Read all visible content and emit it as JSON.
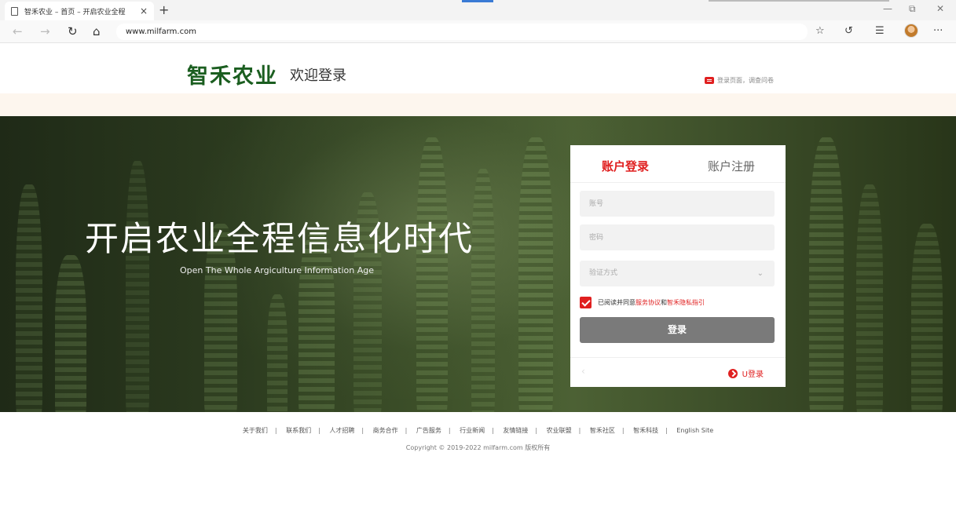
{
  "browser": {
    "tab_title": "智禾农业 – 首页 – 开启农业全程",
    "tab_close": "×",
    "new_tab": "+",
    "url": "www.milfarm.com",
    "window_controls": {
      "minimize": "—",
      "restore": "⧉",
      "close": "✕"
    }
  },
  "header": {
    "logo": "智禾农业",
    "welcome": "欢迎登录",
    "notice": "登录页面，调查问卷"
  },
  "hero": {
    "title": "开启农业全程信息化时代",
    "subtitle": "Open The Whole Argiculture Information Age"
  },
  "login": {
    "tab_login": "账户登录",
    "tab_register": "账户注册",
    "account_placeholder": "账号",
    "password_placeholder": "密码",
    "verify_label": "验证方式",
    "agree_prefix": "已阅读并同意",
    "service_agreement": "服务协议",
    "and": "和",
    "privacy_guide": "智禾隐私指引",
    "submit": "登录",
    "u_login": "U登录",
    "accent_color": "#e02020"
  },
  "footer": {
    "links": [
      "关于我们",
      "联系我们",
      "人才招聘",
      "商务合作",
      "广告服务",
      "行业新闻",
      "友情链接",
      "农业联盟",
      "智禾社区",
      "智禾科技",
      "English Site"
    ],
    "separator": "|",
    "copyright": "Copyright © 2019-2022  milfarm.com 版权所有"
  }
}
